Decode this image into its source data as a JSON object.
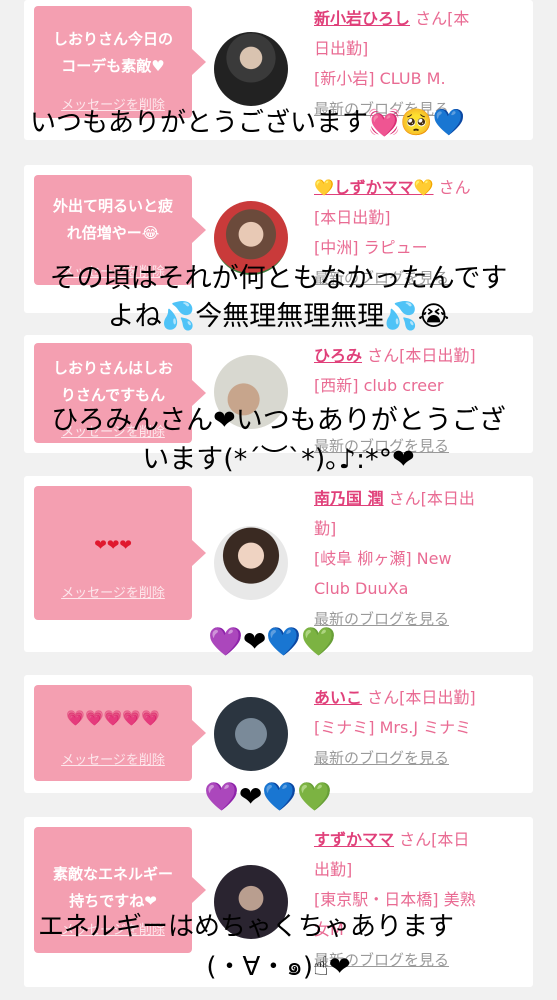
{
  "cards": [
    {
      "bubble": "しおりさん今日の\nコーデも素敵♥",
      "delete": "メッセージを削除",
      "name": "新小岩ひろし",
      "san": "さん[本",
      "line2": "日出勤]",
      "area": "[新小岩] CLUB M.",
      "blog": "最新のブログを見る"
    },
    {
      "bubble": "外出て明るいと疲\nれ倍増やー😂",
      "delete": "メッセージを削除",
      "name": "💛しずかママ💛",
      "san": "さん",
      "line2": "[本日出勤]",
      "area": "[中洲] ラピュー",
      "blog": "最新のブログを見る"
    },
    {
      "bubble": "しおりさんはしお\nりさんですもん",
      "delete": "メッセージを削除",
      "name": "ひろみ",
      "san": "さん[本日出勤]",
      "area": "[西新] club creer",
      "blog": "最新のブログを見る"
    },
    {
      "bubble": "❤❤❤",
      "delete": "メッセージを削除",
      "name": "南乃国 潤",
      "san": "さん[本日出",
      "line2": "勤]",
      "area": "[岐阜 柳ヶ瀬] New",
      "area2": "Club DuuXa",
      "blog": "最新のブログを見る"
    },
    {
      "bubble": "💗💗💗💗💗",
      "delete": "メッセージを削除",
      "name": "あいこ",
      "san": "さん[本日出勤]",
      "area": "[ミナミ] Mrs.J ミナミ",
      "blog": "最新のブログを見る"
    },
    {
      "bubble": "素敵なエネルギー\n持ちですね❤",
      "delete": "メッセージを削除",
      "name": "すずかママ",
      "san": "さん[本日",
      "line2": "出勤]",
      "area": "[東京駅・日本橋] 美熟",
      "area2": "女M",
      "blog": "最新のブログを見る"
    }
  ],
  "overlays": {
    "o1": "いつもありがとうございます💓🥺💙",
    "o2a": "その頃はそれが何ともなかったんです",
    "o2b": "よね💦今無理無理無理💦😭",
    "o3a": "ひろみんさん❤いつもありがとうござ",
    "o3b": "います(*´︶`*)｡♪:*°❤",
    "o4": "💜❤💙💚",
    "o5": "💜❤💙💚",
    "o6a": "エネルギーはめちゃくちゃあります",
    "o6b": "(・∀・๑)☝❤"
  }
}
